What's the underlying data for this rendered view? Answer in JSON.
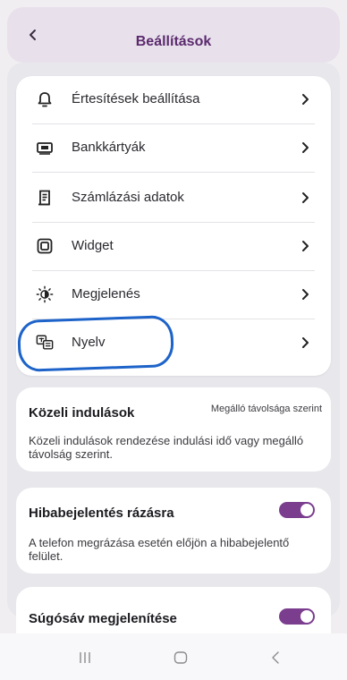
{
  "header": {
    "title": "Beállítások",
    "back_icon": "chevron-left-icon"
  },
  "menu": {
    "items": [
      {
        "label": "Értesítések beállítása",
        "icon": "bell-icon"
      },
      {
        "label": "Bankkártyák",
        "icon": "credit-card-icon"
      },
      {
        "label": "Számlázási adatok",
        "icon": "invoice-icon"
      },
      {
        "label": "Widget",
        "icon": "widget-icon"
      },
      {
        "label": "Megjelenés",
        "icon": "brightness-icon"
      },
      {
        "label": "Nyelv",
        "icon": "translate-icon"
      }
    ]
  },
  "nearby": {
    "title": "Közeli indulások",
    "value": "Megálló távolsága szerint",
    "description": "Közeli indulások rendezése indulási idő vagy megálló távolság szerint."
  },
  "shake": {
    "title": "Hibabejelentés rázásra",
    "description": "A telefon megrázása esetén előjön a hibabejelentő felület.",
    "enabled": true
  },
  "helpbar": {
    "title": "Súgósáv megjelenítése",
    "enabled": true
  },
  "colors": {
    "accent": "#7b3d8e",
    "title": "#5b2a6d",
    "annotation": "#1d63c9"
  },
  "navbar": {
    "icons": [
      "recents-icon",
      "home-icon",
      "back-icon"
    ]
  }
}
